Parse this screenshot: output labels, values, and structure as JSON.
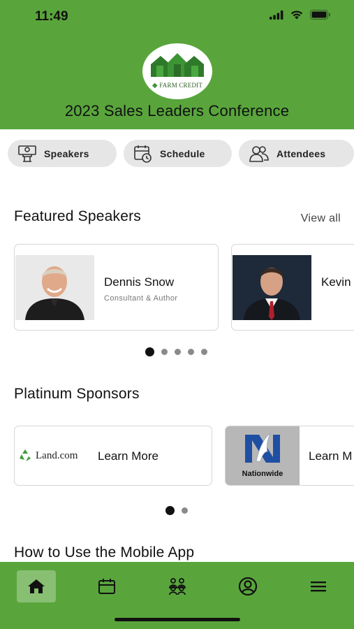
{
  "status_bar": {
    "time": "11:49"
  },
  "header": {
    "logo_text": "Farm Credit",
    "title": "2023 Sales Leaders Conference"
  },
  "quick_links": [
    {
      "label": "Speakers",
      "icon": "speaker-podium-icon"
    },
    {
      "label": "Schedule",
      "icon": "calendar-clock-icon"
    },
    {
      "label": "Attendees",
      "icon": "people-icon"
    }
  ],
  "featured_speakers": {
    "title": "Featured Speakers",
    "view_all": "View all",
    "speakers": [
      {
        "name": "Dennis Snow",
        "role": "Consultant & Author"
      },
      {
        "name": "Kevin",
        "role": ""
      }
    ],
    "pagination": {
      "count": 5,
      "active": 0
    }
  },
  "platinum_sponsors": {
    "title": "Platinum Sponsors",
    "sponsors": [
      {
        "logo_text": "Land.com",
        "cta": "Learn More"
      },
      {
        "logo_text": "Nationwide",
        "cta": "Learn M"
      }
    ],
    "pagination": {
      "count": 2,
      "active": 0
    }
  },
  "how_to": {
    "title": "How to Use the Mobile App"
  },
  "bottom_nav": {
    "items": [
      {
        "icon": "home-icon",
        "active": true
      },
      {
        "icon": "calendar-icon",
        "active": false
      },
      {
        "icon": "people-group-icon",
        "active": false
      },
      {
        "icon": "profile-icon",
        "active": false
      },
      {
        "icon": "menu-icon",
        "active": false
      }
    ]
  },
  "colors": {
    "brand_green": "#59a53c",
    "active_nav_bg": "#88bf73",
    "pill_bg": "#e6e6e6"
  }
}
